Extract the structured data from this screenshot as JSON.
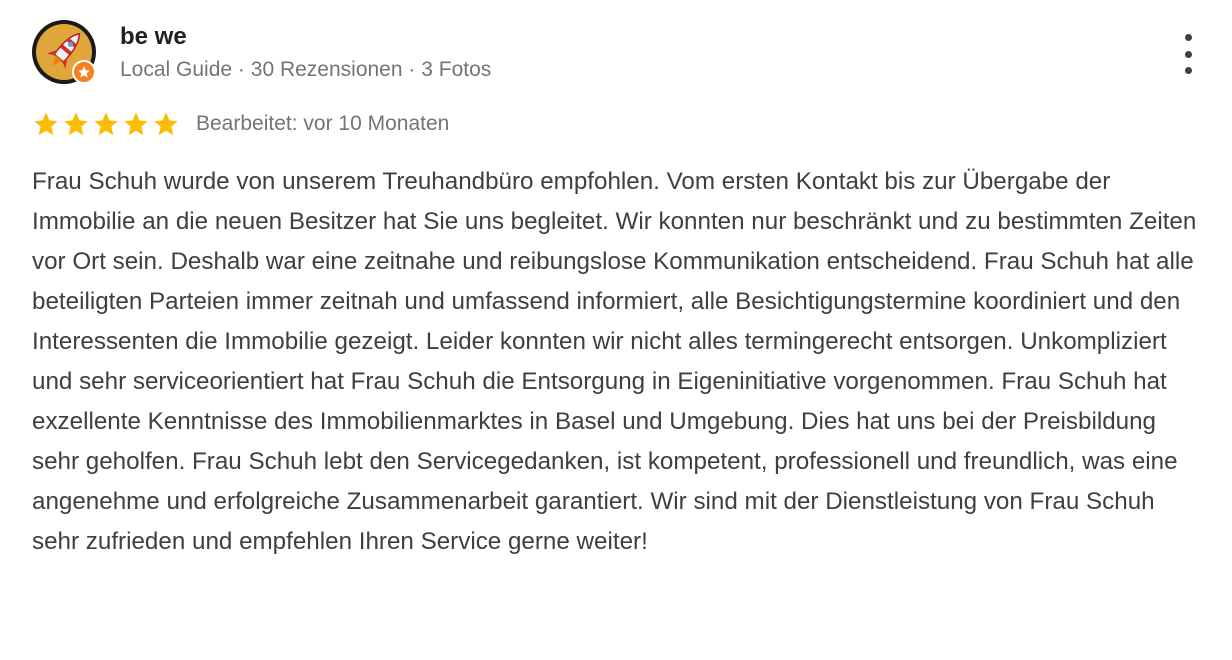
{
  "reviewer": {
    "name": "be we",
    "local_guide": "Local Guide",
    "separator": "·",
    "reviews": "30 Rezensionen",
    "photos": "3 Fotos"
  },
  "rating": {
    "stars": 5,
    "max": 5,
    "color": "#fbbc04"
  },
  "date_label": "Bearbeitet: vor 10 Monaten",
  "review_text": "Frau Schuh wurde von unserem Treuhandbüro empfohlen. Vom ersten Kontakt bis zur Übergabe der Immobilie an die neuen Besitzer hat Sie uns begleitet. Wir konnten nur beschränkt und zu bestimmten Zeiten vor Ort sein. Deshalb war eine zeitnahe und reibungslose Kommunikation entscheidend. Frau Schuh hat alle beteiligten Parteien immer zeitnah und umfassend informiert, alle Besichtigungstermine koordiniert und den Interessenten die Immobilie gezeigt. Leider konnten wir nicht alles termingerecht entsorgen. Unkompliziert und sehr serviceorientiert hat Frau Schuh die Entsorgung in Eigeninitiative vorgenommen. Frau Schuh hat exzellente Kenntnisse des Immobilienmarktes in Basel und Umgebung. Dies hat uns bei der Preisbildung sehr geholfen. Frau Schuh lebt den Servicegedanken, ist kompetent, professionell und freundlich, was eine angenehme und erfolgreiche Zusammenarbeit garantiert. Wir sind mit der Dienstleistung von Frau Schuh sehr zufrieden und empfehlen Ihren Service gerne weiter!",
  "icons": {
    "avatar": "rocket-avatar-icon",
    "badge": "local-guide-star-badge-icon",
    "more": "more-vert-icon",
    "star": "star-icon"
  },
  "colors": {
    "avatar_bg": "#e0a63a",
    "badge": "#f4801f",
    "name": "#202124",
    "secondary": "#70757a",
    "text": "#3c4043"
  }
}
